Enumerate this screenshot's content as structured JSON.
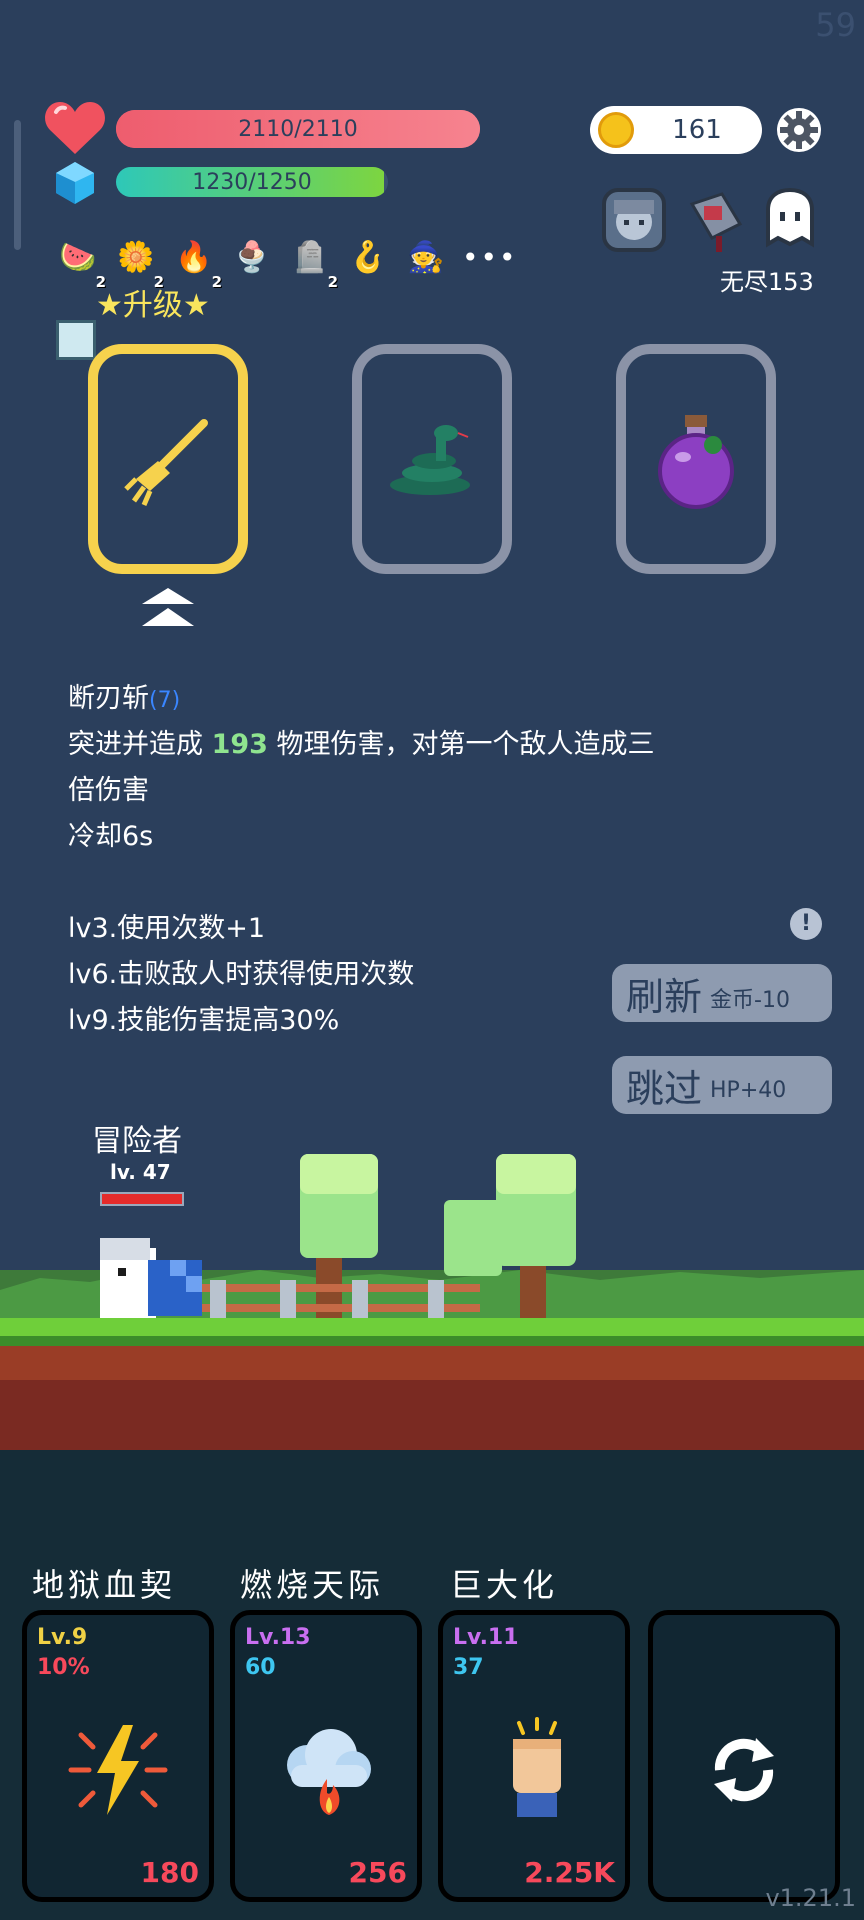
{
  "fps": "59",
  "player": {
    "hp_text": "2110/2110",
    "hp_fraction": 1.0,
    "mp_text": "1230/1250",
    "mp_fraction": 0.984
  },
  "coins": "161",
  "items": [
    {
      "icon": "watermelon-icon",
      "glyph": "🍉",
      "count": "2"
    },
    {
      "icon": "flower-icon",
      "glyph": "🌼",
      "count": "2"
    },
    {
      "icon": "fire-ring-icon",
      "glyph": "🔥",
      "count": "2"
    },
    {
      "icon": "ice-cream-icon",
      "glyph": "🍨",
      "count": ""
    },
    {
      "icon": "tombstone-icon",
      "glyph": "🪦",
      "count": "2"
    },
    {
      "icon": "hook-icon",
      "glyph": "🪝",
      "count": ""
    },
    {
      "icon": "wizard-hat-icon",
      "glyph": "🧙",
      "count": ""
    }
  ],
  "more_label": "•••",
  "companions": [
    "ghost-girl-icon",
    "cursed-sword-icon",
    "ghost-icon"
  ],
  "endless_label": "无尽153",
  "upgrade_label": "★升级★",
  "skill_desc": {
    "name": "断刃斩",
    "level": "(7)",
    "line1_pre": "突进并造成 ",
    "damage": "193",
    "line1_post": " 物理伤害，对第一个敌人造成三",
    "line2": "倍伤害",
    "cooldown": "冷却6s",
    "perks": [
      "lv3.使用次数+1",
      "lv6.击败敌人时获得使用次数",
      "lv9.技能伤害提高30%"
    ]
  },
  "info_icon": "!",
  "refresh_button": {
    "main": "刷新",
    "sub": "金币-10"
  },
  "skip_button": {
    "main": "跳过",
    "sub": "HP+40"
  },
  "hero": {
    "name": "冒险者",
    "level": "lv. 47",
    "hp_fraction": 1.0
  },
  "skills": [
    {
      "title": "地狱血契",
      "lv": "Lv.9",
      "stat": "10%",
      "cost": "180",
      "lv_color": "#f0d145",
      "stat_color": "#f7495b",
      "icon": "lightning-icon"
    },
    {
      "title": "燃烧天际",
      "lv": "Lv.13",
      "stat": "60",
      "cost": "256",
      "lv_color": "#c96ff0",
      "stat_color": "#3ec6f0",
      "icon": "fire-cloud-icon"
    },
    {
      "title": "巨大化",
      "lv": "Lv.11",
      "stat": "37",
      "cost": "2.25K",
      "lv_color": "#c96ff0",
      "stat_color": "#3ec6f0",
      "icon": "fist-icon"
    }
  ],
  "version": "v1.21.1",
  "colors": {
    "background": "#2b3f5c",
    "selected_card": "#f6d24d",
    "card_gray": "#8b93a7",
    "hp": "#ee5d6e",
    "mp": "#2ec8b8"
  }
}
